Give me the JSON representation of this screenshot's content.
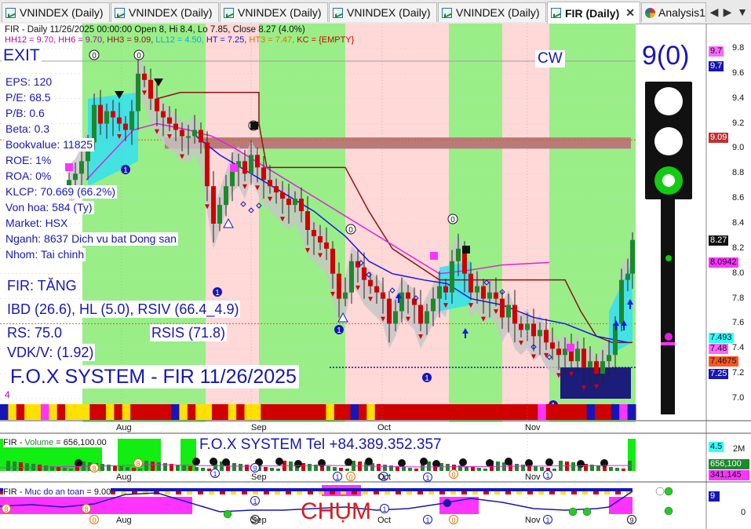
{
  "tabs": [
    {
      "label": "VNINDEX (Daily)",
      "active": false
    },
    {
      "label": "VNINDEX (Daily)",
      "active": false
    },
    {
      "label": "VNINDEX (Daily)",
      "active": false
    },
    {
      "label": "VNINDEX (Daily)",
      "active": false
    },
    {
      "label": "VNINDEX (Daily)",
      "active": false
    },
    {
      "label": "FIR (Daily)",
      "active": true,
      "close": "✕"
    },
    {
      "label": "Analysis1",
      "active": false
    }
  ],
  "nav": {
    "prev": "◀",
    "next": "▶",
    "menu": "▼"
  },
  "info_line": "FIR - Daily 11/26/2025 00:00:00 Open 8, Hi 8.4, Lo 7.85, Close 8.27 (4.0%)",
  "levels_line": [
    {
      "text": "HH12 = 9.70, ",
      "color": "#b8009e"
    },
    {
      "text": "HH6 = 9.70, ",
      "color": "#b8009e"
    },
    {
      "text": "HH3 = 9.09, ",
      "color": "#8a1515"
    },
    {
      "text": "LL12 = 4.50, ",
      "color": "#16a4d8"
    },
    {
      "text": "HT = 7.25, ",
      "color": "#1616b8"
    },
    {
      "text": "HT3 = 7.47, ",
      "color": "#e07000"
    },
    {
      "text": "KC = {EMPTY}",
      "color": "#d00000"
    }
  ],
  "signal": {
    "exit": "EXIT",
    "cw": "CW",
    "count": "9(0)"
  },
  "fundamentals": [
    "EPS: 120",
    "P/E: 68.5",
    "P/B: 0.6",
    "Beta: 0.3",
    "Bookvalue: 11825",
    "ROE: 1%",
    "ROA: 0%",
    "KLCP: 70.669 (66.2%)",
    "Von hoa: 584 (Ty)",
    "Market: HSX",
    "Nganh: 8637 Dich vu bat Dong san",
    "Nhom: Tai chinh"
  ],
  "analysis": {
    "trend": "FIR: TĂNG",
    "ibd": "IBD (26.6), HL (5.0), RSIV (66.4_4.9)",
    "rs": "RS: 75.0",
    "rsis": "RSIS (71.8)",
    "vdk": "VDK/V:  (1.92)"
  },
  "fox_title": "F.O.X SYSTEM - FIR 11/26/2025",
  "small_counter": "4",
  "price_axis": [
    "9.8",
    "9.6",
    "9.4",
    "9.2",
    "9.0",
    "8.8",
    "8.6",
    "8.4",
    "8.2",
    "8.0",
    "7.8",
    "7.6",
    "7.4",
    "7.2",
    "7.0"
  ],
  "price_tags": [
    {
      "text": "9.7",
      "bg": "#ff66ff",
      "fg": "#111111",
      "value": 9.78
    },
    {
      "text": "9.7",
      "bg": "#1616b8",
      "fg": "#ffffff",
      "value": 9.66
    },
    {
      "text": "9.09",
      "bg": "#c03030",
      "fg": "#ffffff",
      "value": 9.09
    },
    {
      "text": "8.27",
      "bg": "#111111",
      "fg": "#ffffff",
      "value": 8.27
    },
    {
      "text": "8.0942",
      "bg": "#ff33ff",
      "fg": "#111111",
      "value": 8.09
    },
    {
      "text": "7.493",
      "bg": "#33ffff",
      "fg": "#111111",
      "value": 7.49
    },
    {
      "text": "7.48",
      "bg": "#ff66ff",
      "fg": "#111111",
      "value": 7.4
    },
    {
      "text": "7.4675",
      "bg": "#ff5522",
      "fg": "#111111",
      "value": 7.3
    },
    {
      "text": "7.25",
      "bg": "#1616b8",
      "fg": "#ffffff",
      "value": 7.2
    },
    {
      "text": "4.5",
      "bg": "#33ffff",
      "fg": "#111111",
      "value": 6.62
    }
  ],
  "x_labels": [
    "Aug",
    "Sep",
    "Oct",
    "Nov"
  ],
  "volume": {
    "title": "FIR - ",
    "title_series": "Volume",
    "title_value": " = 656,100.00",
    "tel": "F.O.X SYSTEM Tel +84.389.352.357",
    "axis": [
      "2M"
    ],
    "tags": [
      {
        "text": "656,100",
        "bg": "#1b8a2b",
        "fg": "#ffffff"
      },
      {
        "text": "341,145",
        "bg": "#ff33ff",
        "fg": "#111111"
      }
    ]
  },
  "safety": {
    "title": "FIR - ",
    "title_series": "Muc do an toan",
    "title_value": " = 9.00",
    "chum": "CHỤM",
    "axis": [
      "0"
    ],
    "tag": {
      "text": "9",
      "bg": "#1616b8",
      "fg": "#ffffff"
    }
  },
  "marker_labels": {
    "zero": "0",
    "one": "1",
    "eight": "8",
    "nine": "9",
    "plus": "+"
  },
  "colors": {
    "up_candle": "#1b8a2b",
    "down_candle": "#d00000",
    "zone_green": "#99ee88",
    "zone_pink": "#ffd8d8",
    "resistance_band": "#b97a7a",
    "accent_blue": "#1616b8"
  },
  "chart_data": {
    "type": "candlestick",
    "title": "FIR - Daily",
    "x": [
      "Aug",
      "Sep",
      "Oct",
      "Nov"
    ],
    "ylim": [
      6.95,
      9.85
    ],
    "last": {
      "open": 8.0,
      "high": 8.4,
      "low": 7.85,
      "close": 8.27,
      "change_pct": 4.0
    },
    "resistance_zone": [
      9.0,
      9.09
    ]
  }
}
